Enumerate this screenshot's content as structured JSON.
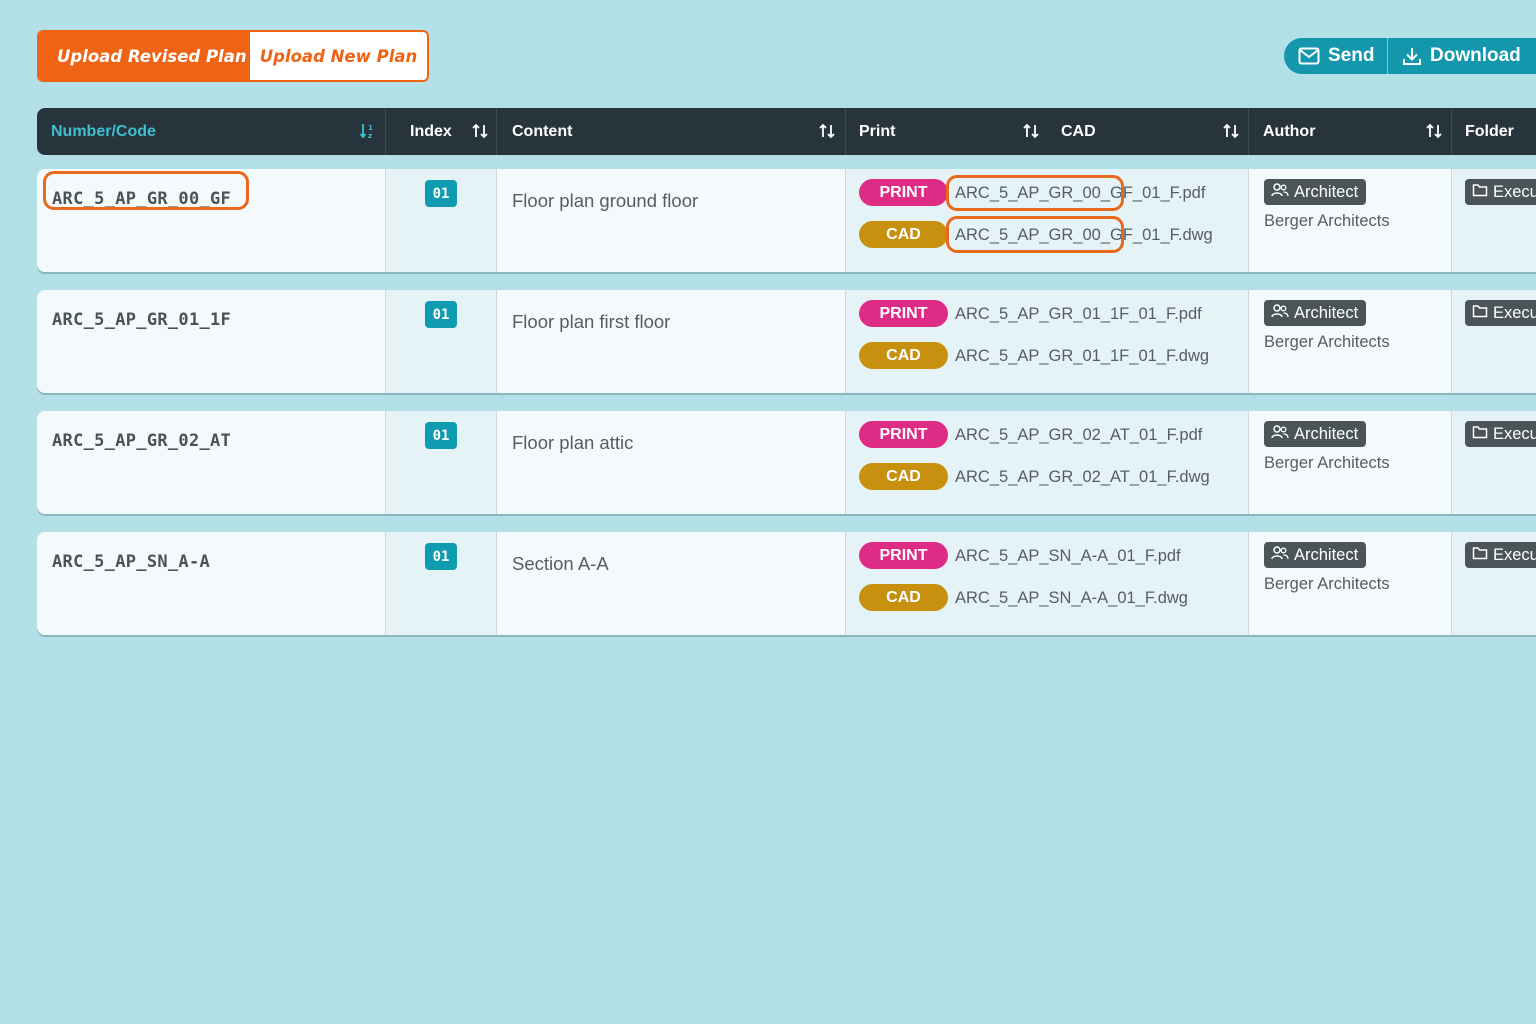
{
  "toolbar": {
    "upload_revised_label": "Upload Revised Plan",
    "upload_new_label": "Upload New Plan",
    "send_label": "Send",
    "download_label": "Download"
  },
  "table": {
    "columns": {
      "number": "Number/Code",
      "index": "Index",
      "content": "Content",
      "print": "Print",
      "cad": "CAD",
      "author": "Author",
      "folder": "Folder"
    },
    "rows": [
      {
        "code": "ARC_5_AP_GR_00_GF",
        "index": "01",
        "content": "Floor plan ground floor",
        "print_label": "PRINT",
        "print_file": "ARC_5_AP_GR_00_GF_01_F.pdf",
        "cad_label": "CAD",
        "cad_file": "ARC_5_AP_GR_00_GF_01_F.dwg",
        "author_role": "Architect",
        "author_name": "Berger Architects",
        "folder": "Execution"
      },
      {
        "code": "ARC_5_AP_GR_01_1F",
        "index": "01",
        "content": "Floor plan first floor",
        "print_label": "PRINT",
        "print_file": "ARC_5_AP_GR_01_1F_01_F.pdf",
        "cad_label": "CAD",
        "cad_file": "ARC_5_AP_GR_01_1F_01_F.dwg",
        "author_role": "Architect",
        "author_name": "Berger Architects",
        "folder": "Execution"
      },
      {
        "code": "ARC_5_AP_GR_02_AT",
        "index": "01",
        "content": "Floor plan attic",
        "print_label": "PRINT",
        "print_file": "ARC_5_AP_GR_02_AT_01_F.pdf",
        "cad_label": "CAD",
        "cad_file": "ARC_5_AP_GR_02_AT_01_F.dwg",
        "author_role": "Architect",
        "author_name": "Berger Architects",
        "folder": "Execution"
      },
      {
        "code": "ARC_5_AP_SN_A-A",
        "index": "01",
        "content": "Section A-A",
        "print_label": "PRINT",
        "print_file": "ARC_5_AP_SN_A-A_01_F.pdf",
        "cad_label": "CAD",
        "cad_file": "ARC_5_AP_SN_A-A_01_F.dwg",
        "author_role": "Architect",
        "author_name": "Berger Architects",
        "folder": "Execution"
      }
    ]
  },
  "icons": {
    "send": "mail-icon",
    "download": "download-icon",
    "sort": "sort-arrows-icon",
    "sort_active": "sort-ascending-icon",
    "author": "users-icon",
    "folder": "folder-icon"
  },
  "colors": {
    "background": "#b2e0e6",
    "accent_orange": "#ef6414",
    "teal": "#1497ad",
    "header_dark": "#27343b",
    "print_pill": "#de2b86",
    "cad_pill": "#c8900f",
    "badge_dark": "#4a5459"
  }
}
